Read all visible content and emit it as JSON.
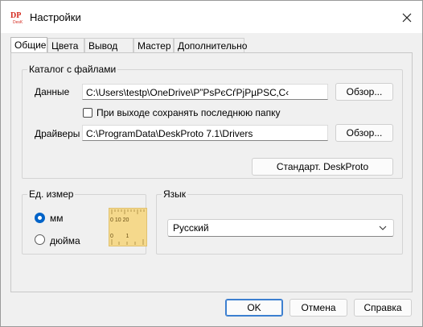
{
  "window": {
    "title": "Настройки",
    "icon": "deskproto-logo-icon",
    "close_icon": "close-icon"
  },
  "tabs": [
    {
      "label": "Общие",
      "active": true
    },
    {
      "label": "Цвета",
      "active": false
    },
    {
      "label": "Вывод УП",
      "active": false
    },
    {
      "label": "Мастер",
      "active": false
    },
    {
      "label": "Дополнительно",
      "active": false
    }
  ],
  "catalog": {
    "title": "Каталог с файлами",
    "data_label": "Данные",
    "data_path": "C:\\Users\\testp\\OneDrive\\Р”РѕРєСѓРјРµРЅС‚С‹",
    "browse_label": "Обзор...",
    "save_folder_label": "При выходе сохранять последнюю папку",
    "drivers_label": "Драйверы",
    "drivers_path": "C:\\ProgramData\\DeskProto 7.1\\Drivers",
    "browse2_label": "Обзор...",
    "standard_label": "Стандарт. DeskProto"
  },
  "units": {
    "title": "Ед. измер",
    "mm_label": "мм",
    "inch_label": "дюйма",
    "selected": "мм",
    "ruler_top": "0  10  20",
    "ruler_bottom": "0        1"
  },
  "language": {
    "title": "Язык",
    "selected": "Русский"
  },
  "footer": {
    "ok_label": "OK",
    "cancel_label": "Отмена",
    "help_label": "Справка"
  },
  "colors": {
    "accent": "#0063c8",
    "logo_red": "#d42a1f",
    "ruler_bg": "#f5d98c"
  }
}
